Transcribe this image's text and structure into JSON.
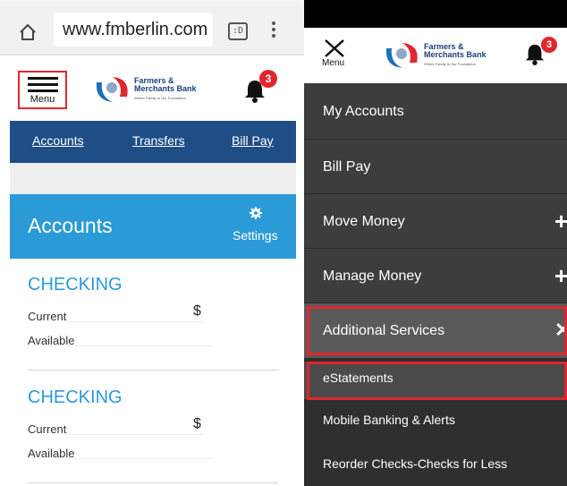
{
  "left": {
    "browser": {
      "url": "www.fmberlin.com",
      "tabs_label": ":D",
      "icons": [
        "home-icon",
        "tabs-icon",
        "overflow-menu-icon"
      ]
    },
    "header": {
      "menu_label": "Menu",
      "logo_name": "Farmers &\nMerchants Bank",
      "logo_tagline": "Where Family Is Our Foundation",
      "notification_count": "3"
    },
    "nav": {
      "links": [
        {
          "label": "Accounts"
        },
        {
          "label": "Transfers"
        },
        {
          "label": "Bill Pay"
        }
      ]
    },
    "accounts_section": {
      "title": "Accounts",
      "settings_label": "Settings"
    },
    "accounts": [
      {
        "type": "CHECKING",
        "current_label": "Current",
        "available_label": "Available",
        "currency": "$"
      },
      {
        "type": "CHECKING",
        "current_label": "Current",
        "available_label": "Available",
        "currency": "$"
      }
    ]
  },
  "right": {
    "header": {
      "menu_label": "Menu",
      "logo_name": "Farmers &\nMerchants Bank",
      "logo_tagline": "Where Family Is Our Foundation",
      "notification_count": "3"
    },
    "menu": [
      {
        "label": "My Accounts",
        "expander": ""
      },
      {
        "label": "Bill Pay",
        "expander": ""
      },
      {
        "label": "Move Money",
        "expander": "+"
      },
      {
        "label": "Manage Money",
        "expander": "+"
      },
      {
        "label": "Additional Services",
        "expander": "✕"
      }
    ],
    "submenu": [
      {
        "label": "eStatements"
      },
      {
        "label": "Mobile Banking & Alerts"
      },
      {
        "label": "Reorder Checks-Checks for Less"
      }
    ]
  },
  "colors": {
    "highlight": "#e0262d",
    "nav_blue": "#1f4e86",
    "accent_blue": "#2a9bd6",
    "drawer_dark": "#3d3d3d"
  }
}
